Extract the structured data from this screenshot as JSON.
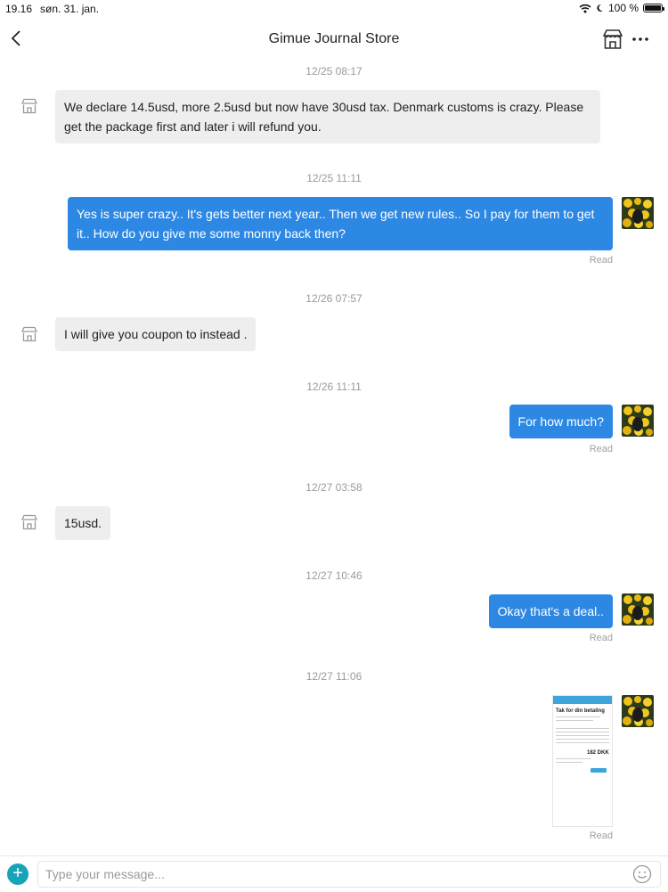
{
  "status_bar": {
    "time": "19.16",
    "date": "søn. 31. jan.",
    "battery": "100 %",
    "battery_level": 1.0
  },
  "header": {
    "title": "Gimue Journal Store"
  },
  "messages": [
    {
      "timestamp": "12/25 08:17",
      "from": "store",
      "text": "We declare 14.5usd, more 2.5usd but now have 30usd tax. Denmark customs is crazy. Please get the package first and later i will refund you."
    },
    {
      "timestamp": "12/25 11:11",
      "from": "me",
      "text": "Yes is super crazy.. It's gets better next year.. Then we get new rules.. So I pay for them to get it.. How do you give me some monny back then?",
      "status": "Read"
    },
    {
      "timestamp": "12/26 07:57",
      "from": "store",
      "text": "I will give you coupon to instead ."
    },
    {
      "timestamp": "12/26 11:11",
      "from": "me",
      "text": "For how much?",
      "status": "Read"
    },
    {
      "timestamp": "12/27 03:58",
      "from": "store",
      "text": "15usd."
    },
    {
      "timestamp": "12/27 10:46",
      "from": "me",
      "text": "Okay that's a deal..",
      "status": "Read"
    },
    {
      "timestamp": "12/27 11:06",
      "from": "me",
      "type": "image",
      "status": "Read",
      "image": {
        "title": "Tak for din betaling",
        "amount": "182 DKK"
      }
    }
  ],
  "input": {
    "placeholder": "Type your message..."
  },
  "colors": {
    "outgoing_bubble": "#2d88e4",
    "incoming_bubble": "#eeeeee",
    "accent": "#17a3b8"
  },
  "icons": [
    "back-chevron-icon",
    "store-icon",
    "more-icon",
    "shop-avatar-icon",
    "plus-icon",
    "emoji-icon"
  ]
}
